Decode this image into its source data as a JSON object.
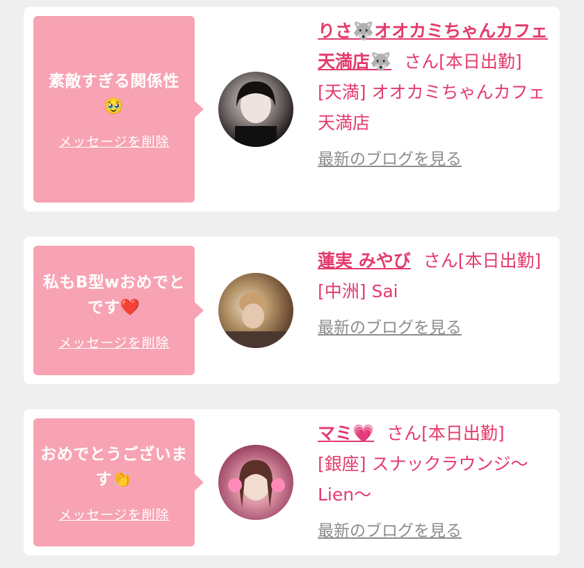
{
  "messages": [
    {
      "text": "素敵すぎる関係性",
      "emoji": "🥹",
      "delete_label": "メッセージを削除",
      "cast_name": "りさ🐺オオカミちゃんカフェ天満店🐺",
      "honorific": "さん",
      "status": "[本日出勤]",
      "shop": "[天満] オオカミちゃんカフェ天満店",
      "blog_label": "最新のブログを見る"
    },
    {
      "text": "私もB型wおめでとです",
      "emoji": "❤️",
      "delete_label": "メッセージを削除",
      "cast_name": "蓮実 みやび",
      "honorific": "さん",
      "status": "[本日出勤]",
      "shop": "[中洲] Sai",
      "blog_label": "最新のブログを見る"
    },
    {
      "text": "おめでとうございます",
      "emoji": "👏",
      "delete_label": "メッセージを削除",
      "cast_name": "マミ💗",
      "honorific": "さん",
      "status": "[本日出勤]",
      "shop": "[銀座] スナックラウンジ〜Lien〜",
      "blog_label": "最新のブログを見る"
    }
  ],
  "colors": {
    "bubble": "#f7a3b3",
    "accent": "#e33a6c",
    "link_gray": "#8c8c8c"
  }
}
